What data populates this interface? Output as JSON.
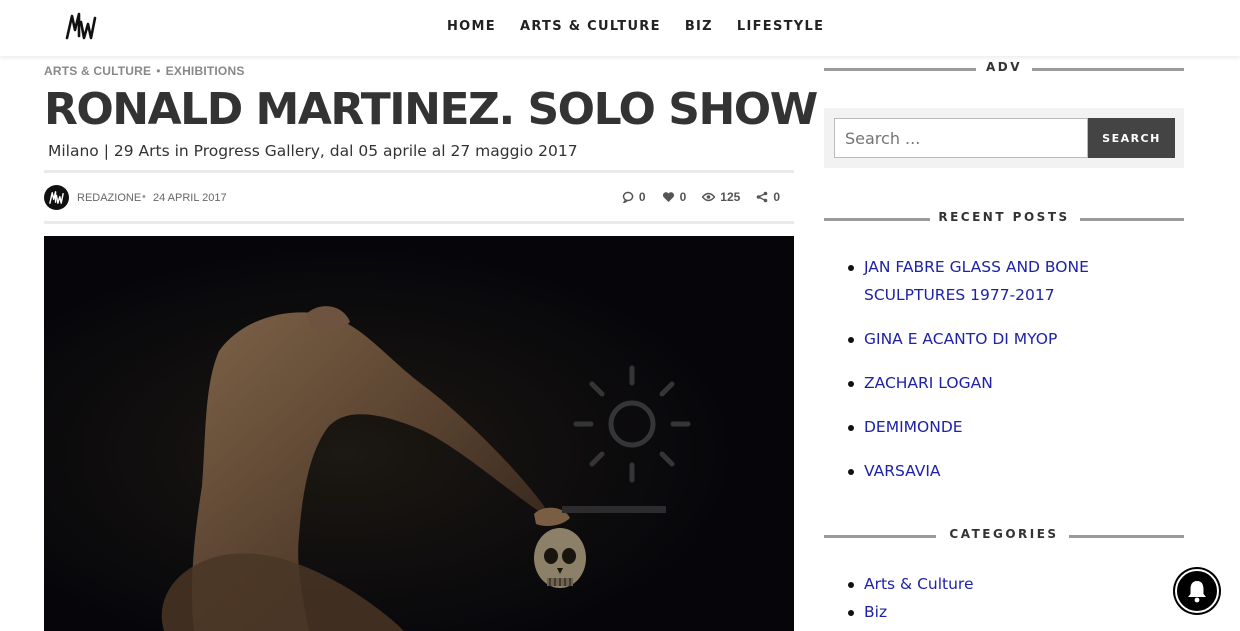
{
  "header": {
    "logo_text": "MW",
    "nav": [
      "HOME",
      "ARTS & CULTURE",
      "BIZ",
      "LIFESTYLE"
    ]
  },
  "article": {
    "breadcrumbs": [
      "ARTS & CULTURE",
      "EXHIBITIONS"
    ],
    "breadcrumb_separator": "•",
    "title": "RONALD MARTINEZ. SOLO SHOW",
    "subtitle": "Milano | 29 Arts in Progress Gallery, dal 05 aprile al 27 maggio 2017",
    "author": "REDAZIONE",
    "meta_separator": "•",
    "date": "24 APRIL 2017",
    "stats": {
      "comments": "0",
      "likes": "0",
      "views": "125",
      "shares": "0"
    },
    "icons": {
      "comments": "comment-icon",
      "likes": "heart-icon",
      "views": "eye-icon",
      "shares": "share-icon"
    }
  },
  "sidebar": {
    "adv_title": "ADV",
    "search": {
      "placeholder": "Search ...",
      "button_label": "SEARCH"
    },
    "recent_posts_title": "RECENT POSTS",
    "recent_posts": [
      "JAN FABRE GLASS AND BONE SCULPTURES 1977-2017",
      "GINA E ACANTO DI MYOP",
      "ZACHARI LOGAN",
      "DEMIMONDE",
      "VARSAVIA"
    ],
    "categories_title": "CATEGORIES",
    "categories": [
      "Arts & Culture",
      "Biz"
    ]
  },
  "colors": {
    "link": "#1d22a8",
    "search_button": "#444444",
    "hero_background": "#07070a"
  }
}
